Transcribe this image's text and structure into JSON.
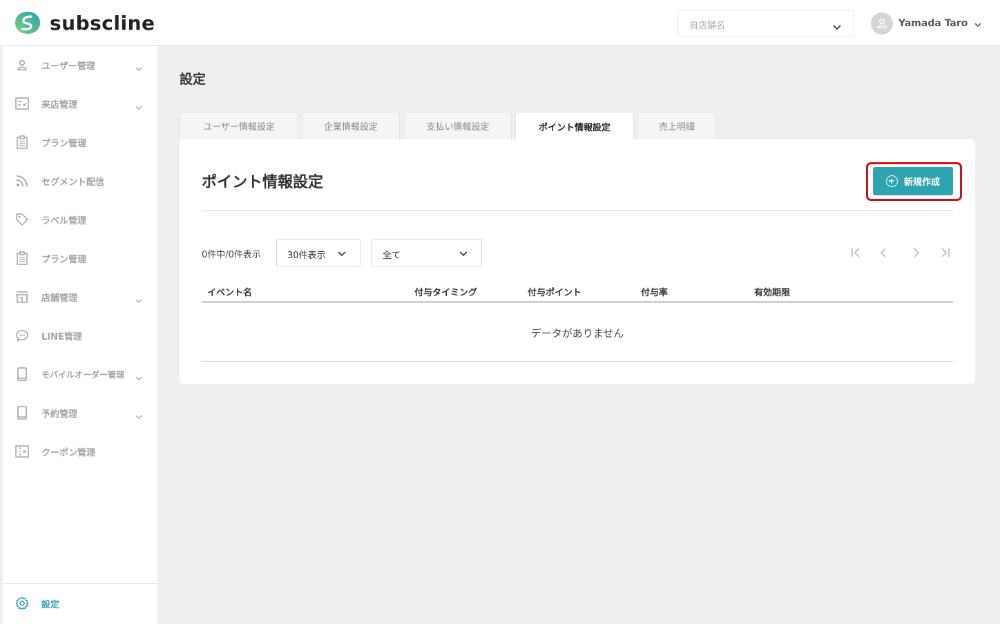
{
  "header": {
    "app_name": "subscline",
    "store_placeholder": "自店舗名",
    "user_name": "Yamada Taro"
  },
  "sidebar": {
    "items": [
      {
        "label": "ユーザー管理",
        "icon": "user-icon",
        "expandable": true
      },
      {
        "label": "来店管理",
        "icon": "checklist-icon",
        "expandable": true
      },
      {
        "label": "プラン管理",
        "icon": "clipboard-icon",
        "expandable": false
      },
      {
        "label": "セグメント配信",
        "icon": "rss-icon",
        "expandable": false
      },
      {
        "label": "ラベル管理",
        "icon": "tag-icon",
        "expandable": false
      },
      {
        "label": "プラン管理",
        "icon": "clipboard-icon",
        "expandable": false
      },
      {
        "label": "店舗管理",
        "icon": "store-icon",
        "expandable": true
      },
      {
        "label": "LINE管理",
        "icon": "chat-icon",
        "expandable": false
      },
      {
        "label": "モバイルオーダー管理",
        "icon": "mobile-icon",
        "expandable": true
      },
      {
        "label": "予約管理",
        "icon": "mobile-icon",
        "expandable": true
      },
      {
        "label": "クーポン管理",
        "icon": "ticket-icon",
        "expandable": false
      }
    ],
    "settings_label": "設定"
  },
  "page": {
    "title": "設定",
    "tabs": [
      {
        "label": "ユーザー情報設定",
        "active": false
      },
      {
        "label": "企業情報設定",
        "active": false
      },
      {
        "label": "支払い情報設定",
        "active": false
      },
      {
        "label": "ポイント情報設定",
        "active": true
      },
      {
        "label": "売上明細",
        "active": false
      }
    ]
  },
  "card": {
    "title": "ポイント情報設定",
    "create_button": "新規作成",
    "count_text": "0件中/0件表示",
    "per_page": "30件表示",
    "filter": "全て",
    "columns": [
      "イベント名",
      "付与タイミング",
      "付与ポイント",
      "付与率",
      "有効期限"
    ],
    "empty_text": "データがありません"
  },
  "colors": {
    "accent": "#2ea4ae",
    "highlight": "#c8141c"
  }
}
